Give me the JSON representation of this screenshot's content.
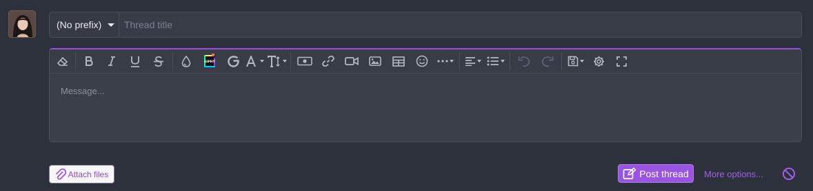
{
  "avatar": {
    "alt": "User avatar"
  },
  "thread": {
    "prefix_label": "(No prefix)",
    "title_placeholder": "Thread title",
    "title_value": ""
  },
  "editor": {
    "toolbar": [
      "eraser-icon",
      "bold-icon",
      "italic-icon",
      "underline-icon",
      "strikethrough-icon",
      "color-drop-icon",
      "giphy-icon",
      "google-icon",
      "font-size-icon",
      "text-height-icon",
      "money-icon",
      "link-icon",
      "video-icon",
      "image-icon",
      "table-icon",
      "smile-icon",
      "more-icon",
      "align-icon",
      "list-icon",
      "undo-icon",
      "redo-icon",
      "save-drafts-icon",
      "gear-icon",
      "fullscreen-icon"
    ],
    "giphy_text": "GIPHY",
    "message_placeholder": "Message..."
  },
  "footer": {
    "attach_label": "Attach files",
    "post_label": "Post thread",
    "more_options_label": "More options..."
  },
  "colors": {
    "accent": "#9a53e3",
    "link": "#a55ee8",
    "background": "#2c313c"
  }
}
